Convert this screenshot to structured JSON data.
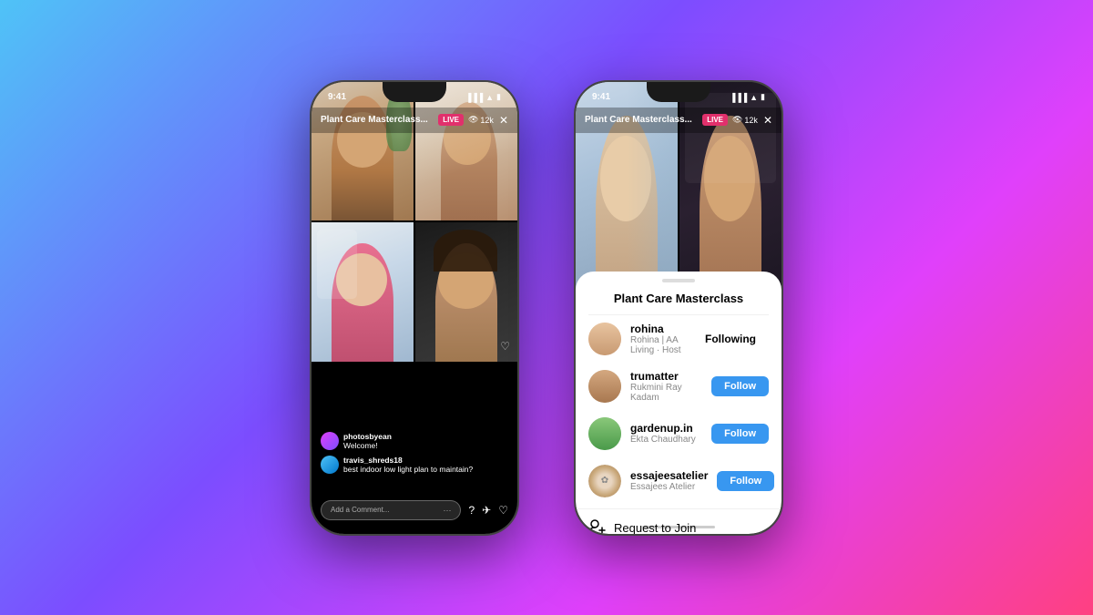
{
  "background": {
    "gradient": "linear-gradient(135deg, #4fc3f7 0%, #7c4dff 40%, #e040fb 70%, #ff4081 100%)"
  },
  "phone1": {
    "status_time": "9:41",
    "title": "Plant Care Masterclass...",
    "live_label": "LIVE",
    "viewer_count": "12k",
    "comments": [
      {
        "user": "photosbyean",
        "text": "Welcome!"
      },
      {
        "user": "travis_shreds18",
        "text": "best indoor low light plan to maintain?"
      }
    ],
    "add_comment_placeholder": "Add a Comment...",
    "bottom_icons": [
      "···",
      "?",
      "✈",
      "♡"
    ]
  },
  "phone2": {
    "status_time": "9:41",
    "title": "Plant Care Masterclass...",
    "live_label": "LIVE",
    "viewer_count": "12k",
    "sheet": {
      "title": "Plant Care Masterclass",
      "handle": true,
      "participants": [
        {
          "id": "rohina",
          "username": "rohina",
          "subtitle": "Rohina | AA Living · Host",
          "action": "Following"
        },
        {
          "id": "trumatter",
          "username": "trumatter",
          "subtitle": "Rukmini Ray Kadam",
          "action": "Follow"
        },
        {
          "id": "gardenup",
          "username": "gardenup.in",
          "subtitle": "Ekta Chaudhary",
          "action": "Follow"
        },
        {
          "id": "essajees",
          "username": "essajeesatelier",
          "subtitle": "Essajees Atelier",
          "action": "Follow"
        }
      ],
      "request_join_label": "Request to Join"
    }
  }
}
